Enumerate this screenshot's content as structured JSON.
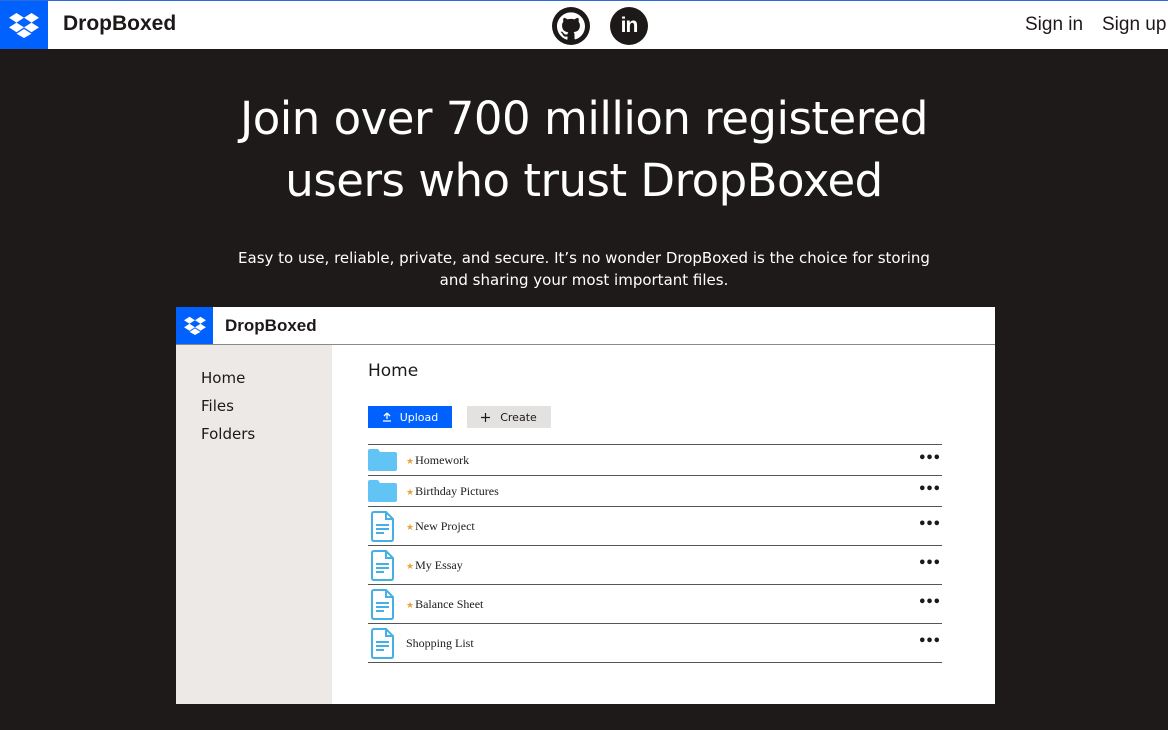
{
  "nav": {
    "brand": "DropBoxed",
    "signin_label": "Sign in",
    "signup_label": "Sign up",
    "linkedin_text": "in"
  },
  "hero": {
    "title_line1": "Join over 700 million registered",
    "title_line2": "users who trust DropBoxed",
    "subtitle": "Easy to use, reliable, private, and secure. It’s no wonder DropBoxed is the choice for storing and sharing your most important files."
  },
  "mock": {
    "brand": "DropBoxed",
    "sidebar": [
      {
        "label": "Home"
      },
      {
        "label": "Files"
      },
      {
        "label": "Folders"
      }
    ],
    "main_title": "Home",
    "upload_label": "Upload",
    "create_label": "Create",
    "files": [
      {
        "name": "Homework",
        "type": "folder",
        "starred": true
      },
      {
        "name": "Birthday Pictures",
        "type": "folder",
        "starred": true
      },
      {
        "name": "New Project",
        "type": "doc",
        "starred": true
      },
      {
        "name": "My Essay",
        "type": "doc",
        "starred": true
      },
      {
        "name": "Balance Sheet",
        "type": "doc",
        "starred": true
      },
      {
        "name": "Shopping List",
        "type": "doc",
        "starred": false
      }
    ],
    "more_label": "•••"
  },
  "colors": {
    "brand_blue": "#0061fe",
    "background": "#1e1a19",
    "star": "#e5a53a",
    "folder": "#62c3f5"
  }
}
